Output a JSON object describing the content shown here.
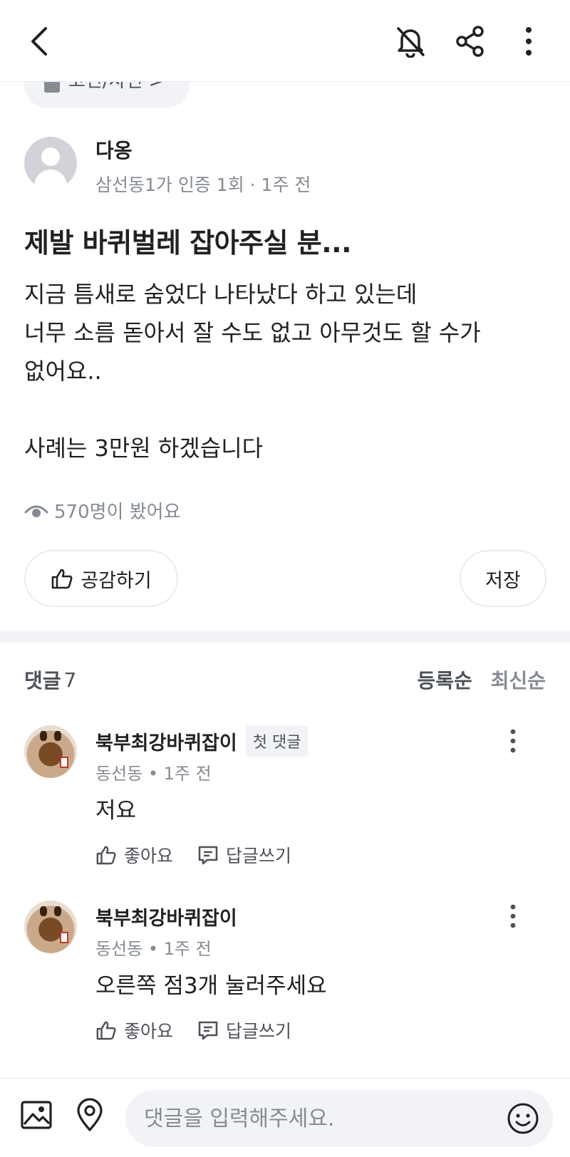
{
  "category": {
    "label": "고민/사연 >"
  },
  "author": {
    "name": "다옹",
    "meta": "삼선동1가 인증 1회 · 1주 전"
  },
  "post": {
    "title": "제발 바퀴벌레 잡아주실 분...",
    "lines": [
      "지금 틈새로 숨었다 나타났다 하고 있는데",
      "너무 소름 돋아서 잘 수도 없고 아무것도 할 수가",
      "없어요..",
      "",
      "사례는 3만원 하겠습니다"
    ],
    "views": "570명이 봤어요"
  },
  "actions": {
    "like_label": "공감하기",
    "save_label": "저장"
  },
  "comments_header": {
    "label": "댓글",
    "count": "7",
    "sort_registered": "등록순",
    "sort_latest": "최신순"
  },
  "comments": [
    {
      "name": "북부최강바퀴잡이",
      "badge": "첫 댓글",
      "meta": "동선동 • 1주 전",
      "text": "저요",
      "like": "좋아요",
      "reply": "답글쓰기"
    },
    {
      "name": "북부최강바퀴잡이",
      "badge": "",
      "meta": "동선동 • 1주 전",
      "text": "오른쪽 점3개 눌러주세요",
      "like": "좋아요",
      "reply": "답글쓰기"
    }
  ],
  "input": {
    "placeholder": "댓글을 입력해주세요."
  },
  "colors": {
    "text": "#212124",
    "muted": "#868b94",
    "chip_bg": "#f2f3f6",
    "border": "#e9ecef"
  },
  "icons": [
    "back-icon",
    "bell-off-icon",
    "share-icon",
    "more-vertical-icon",
    "eye-icon",
    "thumbs-up-icon",
    "reply-icon",
    "gallery-icon",
    "location-icon",
    "emoji-icon"
  ]
}
